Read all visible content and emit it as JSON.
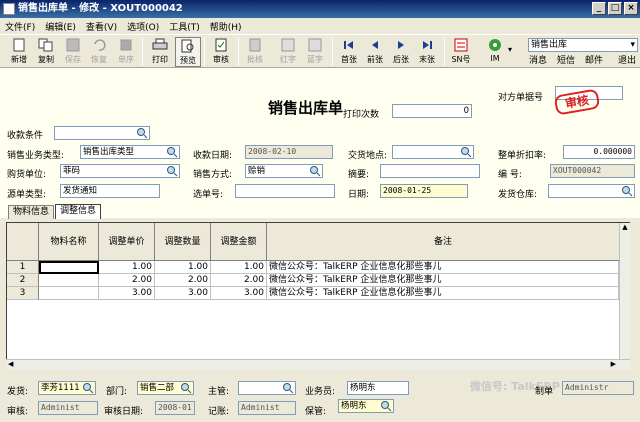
{
  "window": {
    "title": "销售出库单 - 修改 - XOUT000042"
  },
  "menu": [
    "文件(F)",
    "编辑(E)",
    "查看(V)",
    "选项(O)",
    "工具(T)",
    "帮助(H)"
  ],
  "toolbar": {
    "new": "新增",
    "copy": "复制",
    "save": "保存",
    "restore": "恢复",
    "delete": "单序",
    "print": "打印",
    "preview": "预览",
    "audit": "审核",
    "approve": "批核",
    "red": "红字",
    "blue": "蓝字",
    "first": "首张",
    "prev": "前张",
    "next": "后张",
    "last": "末张",
    "sn": "SN号",
    "im": "IM",
    "combo": "销售出库",
    "message": "消息",
    "sms": "短信",
    "mail": "邮件",
    "exit": "退出"
  },
  "header": {
    "doc_title": "销售出库单",
    "print_count_label": "打印次数",
    "print_count": "0",
    "ref_label": "对方单据号",
    "stamp": "审核",
    "collect_cond_label": "收款条件",
    "biz_type_label": "销售业务类型:",
    "biz_type": "销售出库类型",
    "collect_date_label": "收款日期:",
    "collect_date": "2008-02-10",
    "place_label": "交货地点:",
    "discount_label": "整单折扣率:",
    "discount": "0.000000",
    "buyer_label": "购货单位:",
    "buyer": "菲码",
    "sale_mode_label": "销售方式:",
    "sale_mode": "赊销",
    "summary_label": "摘要:",
    "code_label": "编    号:",
    "code": "XOUT000042",
    "src_type_label": "源单类型:",
    "src_type": "发货通知",
    "sel_no_label": "选单号:",
    "date_label": "日期:",
    "date": "2008-01-25",
    "warehouse_label": "发货仓库:"
  },
  "tabs": [
    "物料信息",
    "调整信息"
  ],
  "grid": {
    "columns": [
      "物料名称",
      "调整单价",
      "调整数量",
      "调整金额",
      "备注"
    ],
    "rows": [
      {
        "no": "1",
        "price": "1.00",
        "qty": "1.00",
        "amount": "1.00",
        "note": "微信公众号：TalkERP 企业信息化那些事儿"
      },
      {
        "no": "2",
        "price": "2.00",
        "qty": "2.00",
        "amount": "2.00",
        "note": "微信公众号：TalkERP 企业信息化那些事儿"
      },
      {
        "no": "3",
        "price": "3.00",
        "qty": "3.00",
        "amount": "3.00",
        "note": "微信公众号：TalkERP 企业信息化那些事儿"
      }
    ]
  },
  "footer": {
    "ship_label": "发货:",
    "ship": "李芳1111",
    "dept_label": "部门:",
    "dept": "销售二部",
    "manager_label": "主管:",
    "salesman_label": "业务员:",
    "salesman": "杨明东",
    "maker_label": "制单",
    "maker": "Administr",
    "auditor_label": "审核:",
    "auditor": "Administ",
    "audit_date_label": "审核日期:",
    "audit_date": "2008-01",
    "booker_label": "记账:",
    "booker": "Administ",
    "keeper_label": "保管:",
    "keeper": "杨明东",
    "watermark": "微信号: TalkERP"
  }
}
